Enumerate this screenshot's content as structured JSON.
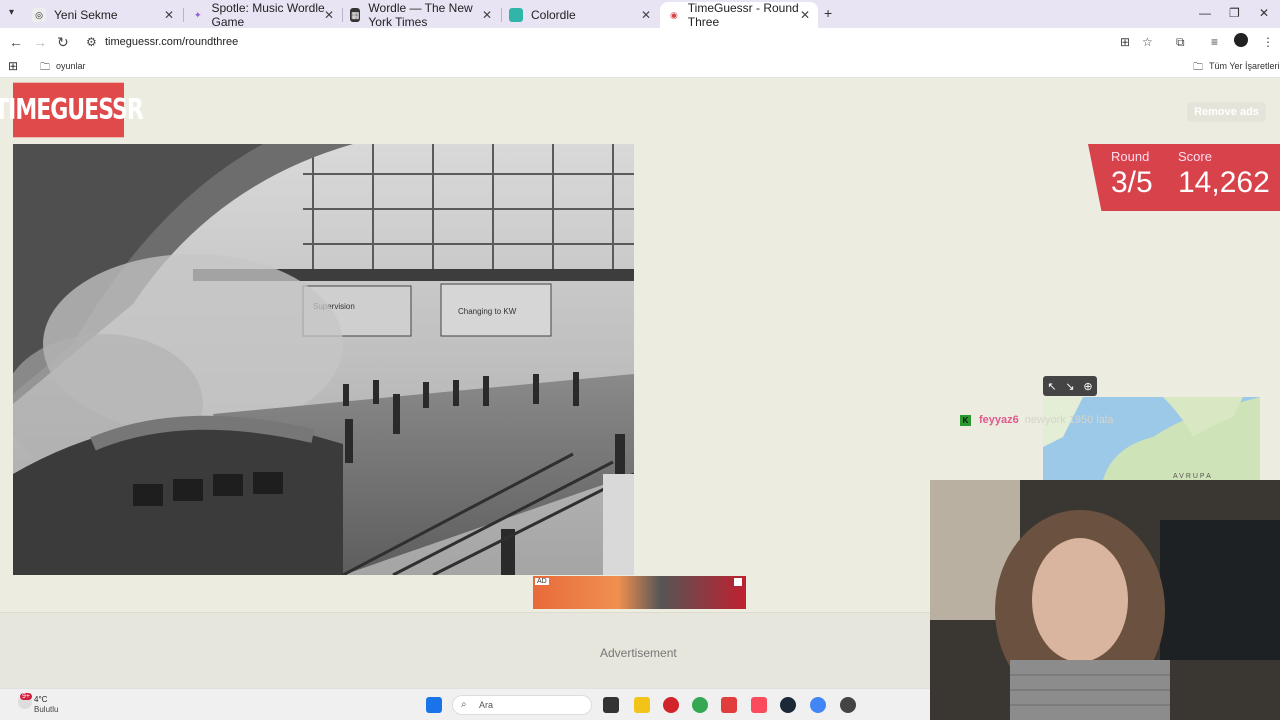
{
  "browser": {
    "tabs": [
      {
        "label": "Yeni Sekme",
        "active": false
      },
      {
        "label": "Spotle: Music Wordle Game",
        "active": false
      },
      {
        "label": "Wordle — The New York Times",
        "active": false
      },
      {
        "label": "Colordle",
        "active": false
      },
      {
        "label": "TimeGuessr - Round Three",
        "active": true
      }
    ],
    "url": "timeguessr.com/roundthree",
    "bookmarks": {
      "folder": "oyunlar",
      "all_bookmarks": "Tüm Yer İşaretleri"
    }
  },
  "page": {
    "logo": "TIMEGUESSR",
    "remove_ads": "Remove ads",
    "round_label": "Round",
    "round_value": "3/5",
    "score_label": "Score",
    "score_value": "14,262",
    "ad_tag": "AD",
    "advertisement": "Advertisement",
    "photo_signs": {
      "left": "Supervision",
      "right": "Changing to KW"
    }
  },
  "map": {
    "label": "AVRUPA"
  },
  "chat": {
    "badge": "K",
    "user": "feyyaz6",
    "message": "newyork 1950 lala"
  },
  "taskbar": {
    "weather_badge": "9+",
    "temperature": "4°C",
    "condition": "Bulutlu",
    "search_placeholder": "Ara"
  },
  "colors": {
    "accent_red": "#d8434b",
    "logo_red": "#e04a4a",
    "page_bg": "#ecece1"
  }
}
